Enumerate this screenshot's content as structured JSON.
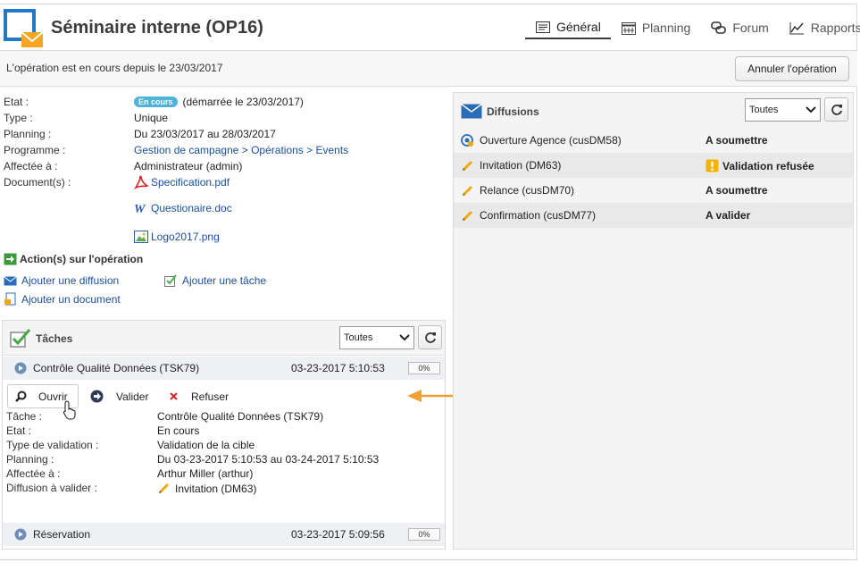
{
  "header": {
    "title": "Séminaire interne (OP16)",
    "tabs": [
      {
        "label": "Général",
        "icon": "general-icon",
        "active": true
      },
      {
        "label": "Planning",
        "icon": "calendar-icon",
        "active": false
      },
      {
        "label": "Forum",
        "icon": "forum-icon",
        "active": false
      },
      {
        "label": "Rapports",
        "icon": "chart-icon",
        "active": false
      }
    ]
  },
  "status_bar": {
    "text": "L'opération est en cours depuis le 23/03/2017",
    "cancel_button": "Annuler l'opération"
  },
  "properties": {
    "etat_label": "Etat :",
    "etat_badge": "En cours",
    "etat_value": "(démarrée le 23/03/2017)",
    "type_label": "Type :",
    "type_value": "Unique",
    "planning_label": "Planning :",
    "planning_value": "Du 23/03/2017 au 28/03/2017",
    "programme_label": "Programme :",
    "programme_value": "Gestion de campagne > Opérations > Events",
    "affectee_label": "Affectée à :",
    "affectee_value": "Administrateur (admin)",
    "documents_label": "Document(s) :",
    "documents": [
      "Specification.pdf",
      "Questionaire.doc",
      "Logo2017.png"
    ]
  },
  "actions": {
    "title": "Action(s) sur l'opération",
    "add_diffusion": "Ajouter une diffusion",
    "add_task": "Ajouter une tâche",
    "add_document": "Ajouter un document"
  },
  "tasks": {
    "title": "Tâches",
    "filter": "Toutes",
    "items": [
      {
        "name": "Contrôle Qualité Données (TSK79)",
        "date": "03-23-2017 5:10:53",
        "progress": "0%"
      },
      {
        "name": "Réservation",
        "date": "03-23-2017 5:09:56",
        "progress": "0%"
      }
    ],
    "detail": {
      "open_button": "Ouvrir",
      "validate_button": "Valider",
      "refuse_button": "Refuser",
      "tache_label": "Tâche :",
      "tache_value": "Contrôle Qualité Données (TSK79)",
      "etat_label": "Etat :",
      "etat_value": "En cours",
      "type_label": "Type de validation :",
      "type_value": "Validation de la cible",
      "planning_label": "Planning :",
      "planning_value": "Du 03-23-2017 5:10:53 au 03-24-2017 5:10:53",
      "affectee_label": "Affectée à :",
      "affectee_value": "Arthur Miller (arthur)",
      "diffusion_label": "Diffusion à valider :",
      "diffusion_value": "Invitation (DM63)"
    }
  },
  "diffusions": {
    "title": "Diffusions",
    "filter": "Toutes",
    "items": [
      {
        "name": "Ouverture Agence (cusDM58)",
        "status": "A soumettre",
        "icon": "delivery-target-icon"
      },
      {
        "name": "Invitation (DM63)",
        "status": "Validation refusée",
        "icon": "pencil-icon",
        "warning": true
      },
      {
        "name": "Relance (cusDM70)",
        "status": "A soumettre",
        "icon": "pencil-icon"
      },
      {
        "name": "Confirmation (cusDM77)",
        "status": "A valider",
        "icon": "pencil-icon"
      }
    ]
  },
  "colors": {
    "accent_blue": "#1a4f9c",
    "badge_blue": "#4fb3d9",
    "annotation_orange": "#f0a030",
    "warning_yellow": "#f2b400"
  }
}
